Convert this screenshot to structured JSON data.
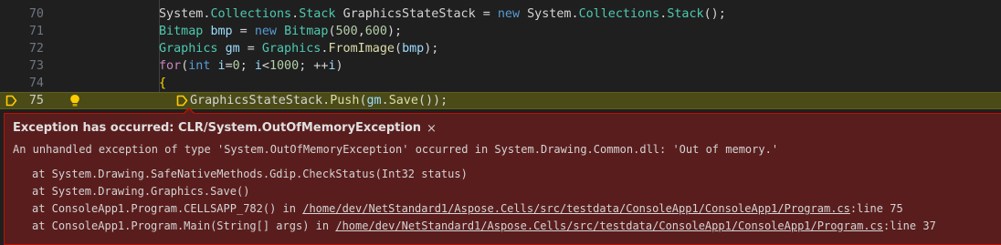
{
  "editor": {
    "lines": [
      {
        "num": "70",
        "tokens": [
          {
            "t": "System",
            "c": "t-plain"
          },
          {
            "t": ".",
            "c": "t-plain"
          },
          {
            "t": "Collections",
            "c": "t-type"
          },
          {
            "t": ".",
            "c": "t-plain"
          },
          {
            "t": "Stack",
            "c": "t-type"
          },
          {
            "t": " ",
            "c": "t-plain"
          },
          {
            "t": "GraphicsStateStack",
            "c": "t-plain"
          },
          {
            "t": " = ",
            "c": "t-plain"
          },
          {
            "t": "new",
            "c": "t-kw"
          },
          {
            "t": " System",
            "c": "t-plain"
          },
          {
            "t": ".",
            "c": "t-plain"
          },
          {
            "t": "Collections",
            "c": "t-type"
          },
          {
            "t": ".",
            "c": "t-plain"
          },
          {
            "t": "Stack",
            "c": "t-type"
          },
          {
            "t": "();",
            "c": "t-plain"
          }
        ]
      },
      {
        "num": "71",
        "tokens": [
          {
            "t": "Bitmap",
            "c": "t-type"
          },
          {
            "t": " ",
            "c": "t-plain"
          },
          {
            "t": "bmp",
            "c": "t-id"
          },
          {
            "t": " = ",
            "c": "t-plain"
          },
          {
            "t": "new",
            "c": "t-kw"
          },
          {
            "t": " ",
            "c": "t-plain"
          },
          {
            "t": "Bitmap",
            "c": "t-type"
          },
          {
            "t": "(",
            "c": "t-plain"
          },
          {
            "t": "500",
            "c": "t-num"
          },
          {
            "t": ",",
            "c": "t-plain"
          },
          {
            "t": "600",
            "c": "t-num"
          },
          {
            "t": ");",
            "c": "t-plain"
          }
        ]
      },
      {
        "num": "72",
        "tokens": [
          {
            "t": "Graphics",
            "c": "t-type"
          },
          {
            "t": " ",
            "c": "t-plain"
          },
          {
            "t": "gm",
            "c": "t-id"
          },
          {
            "t": " = ",
            "c": "t-plain"
          },
          {
            "t": "Graphics",
            "c": "t-type"
          },
          {
            "t": ".",
            "c": "t-plain"
          },
          {
            "t": "FromImage",
            "c": "t-fn"
          },
          {
            "t": "(",
            "c": "t-plain"
          },
          {
            "t": "bmp",
            "c": "t-id"
          },
          {
            "t": ");",
            "c": "t-plain"
          }
        ]
      },
      {
        "num": "73",
        "tokens": [
          {
            "t": "for",
            "c": "t-ctrl"
          },
          {
            "t": "(",
            "c": "t-plain"
          },
          {
            "t": "int",
            "c": "t-kw"
          },
          {
            "t": " ",
            "c": "t-plain"
          },
          {
            "t": "i",
            "c": "t-id"
          },
          {
            "t": "=",
            "c": "t-plain"
          },
          {
            "t": "0",
            "c": "t-num"
          },
          {
            "t": "; ",
            "c": "t-plain"
          },
          {
            "t": "i",
            "c": "t-id"
          },
          {
            "t": "<",
            "c": "t-plain"
          },
          {
            "t": "1000",
            "c": "t-num"
          },
          {
            "t": "; ++",
            "c": "t-plain"
          },
          {
            "t": "i",
            "c": "t-id"
          },
          {
            "t": ")",
            "c": "t-plain"
          }
        ]
      },
      {
        "num": "74",
        "tokens": [
          {
            "t": "{",
            "c": "t-brace"
          }
        ]
      },
      {
        "num": "75",
        "tokens": [
          {
            "t": "GraphicsStateStack",
            "c": "t-plain"
          },
          {
            "t": ".",
            "c": "t-plain"
          },
          {
            "t": "Push",
            "c": "t-fn"
          },
          {
            "t": "(",
            "c": "t-plain"
          },
          {
            "t": "gm",
            "c": "t-id"
          },
          {
            "t": ".",
            "c": "t-plain"
          },
          {
            "t": "Save",
            "c": "t-fn"
          },
          {
            "t": "());",
            "c": "t-plain"
          }
        ]
      }
    ]
  },
  "exception": {
    "title": "Exception has occurred: CLR/System.OutOfMemoryException",
    "close_glyph": "×",
    "message": "An unhandled exception of type 'System.OutOfMemoryException' occurred in System.Drawing.Common.dll: 'Out of memory.'",
    "stack": [
      {
        "prefix": "at System.Drawing.SafeNativeMethods.Gdip.CheckStatus(Int32 status)",
        "link": "",
        "suffix": ""
      },
      {
        "prefix": "at System.Drawing.Graphics.Save()",
        "link": "",
        "suffix": ""
      },
      {
        "prefix": "at ConsoleApp1.Program.CELLSAPP_782() in ",
        "link": "/home/dev/NetStandard1/Aspose.Cells/src/testdata/ConsoleApp1/ConsoleApp1/Program.cs",
        "suffix": ":line 75"
      },
      {
        "prefix": "at ConsoleApp1.Program.Main(String[] args) in ",
        "link": "/home/dev/NetStandard1/Aspose.Cells/src/testdata/ConsoleApp1/ConsoleApp1/Program.cs",
        "suffix": ":line 37"
      }
    ]
  },
  "icons": {
    "debug_pointer": "debug-stackframe-icon",
    "lightbulb": "lightbulb-icon"
  },
  "colors": {
    "current_line": "#4b4b18",
    "debug_arrow": "#ffcc00",
    "exception_bg": "#5a1d1d",
    "exception_border": "#be1100"
  }
}
